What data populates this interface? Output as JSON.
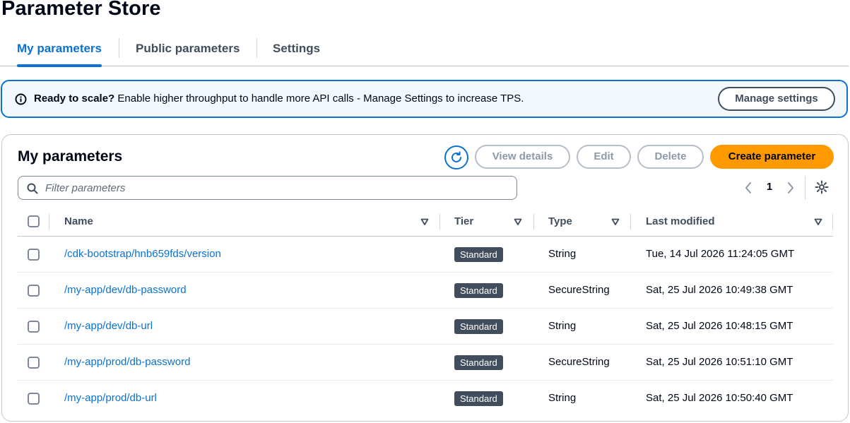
{
  "page": {
    "title": "Parameter Store"
  },
  "tabs": [
    {
      "label": "My parameters",
      "active": true
    },
    {
      "label": "Public parameters",
      "active": false
    },
    {
      "label": "Settings",
      "active": false
    }
  ],
  "alert": {
    "icon": "info-icon",
    "title": "Ready to scale?",
    "message": "Enable higher throughput to handle more API calls - Manage Settings to increase TPS.",
    "button_label": "Manage settings",
    "accent_color": "#0972d3"
  },
  "panel": {
    "title": "My parameters",
    "actions": {
      "refresh_icon": "refresh-icon",
      "view_details": "View details",
      "edit": "Edit",
      "delete": "Delete",
      "create": "Create parameter"
    },
    "filter_placeholder": "Filter parameters",
    "pagination": {
      "current_page": "1"
    },
    "primary_color": "#ff9900"
  },
  "table": {
    "columns": [
      "Name",
      "Tier",
      "Type",
      "Last modified"
    ],
    "rows": [
      {
        "name": "/cdk-bootstrap/hnb659fds/version",
        "tier": "Standard",
        "type": "String",
        "last_modified": "Tue, 14 Jul 2026 11:24:05 GMT"
      },
      {
        "name": "/my-app/dev/db-password",
        "tier": "Standard",
        "type": "SecureString",
        "last_modified": "Sat, 25 Jul 2026 10:49:38 GMT"
      },
      {
        "name": "/my-app/dev/db-url",
        "tier": "Standard",
        "type": "String",
        "last_modified": "Sat, 25 Jul 2026 10:48:15 GMT"
      },
      {
        "name": "/my-app/prod/db-password",
        "tier": "Standard",
        "type": "SecureString",
        "last_modified": "Sat, 25 Jul 2026 10:51:10 GMT"
      },
      {
        "name": "/my-app/prod/db-url",
        "tier": "Standard",
        "type": "String",
        "last_modified": "Sat, 25 Jul 2026 10:50:40 GMT"
      }
    ]
  }
}
